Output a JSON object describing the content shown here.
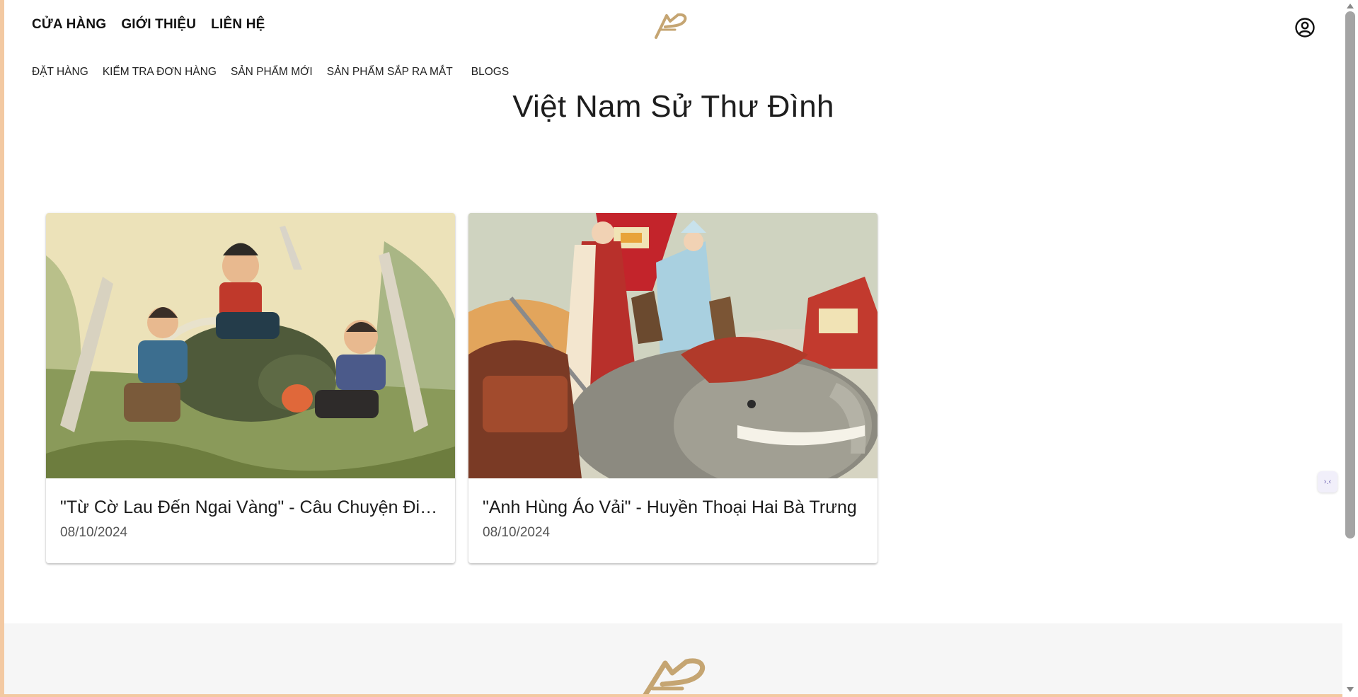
{
  "header": {
    "main_nav": [
      "CỬA HÀNG",
      "GIỚI THIỆU",
      "LIÊN HỆ"
    ],
    "sub_nav": [
      "ĐẶT HÀNG",
      "KIỂM TRA ĐƠN HÀNG",
      "SẢN PHẨM MỚI",
      "SẢN PHẨM SẮP RA MẮT",
      "BLOGS"
    ],
    "logo_icon": "brand-logo-icon",
    "account_icon": "account-circle-icon"
  },
  "page_title": "Việt Nam Sử Thư Đình",
  "posts": [
    {
      "title": "\"Từ Cờ Lau Đến Ngai Vàng\" - Câu Chuyện Đinh Bộ Lĩnh",
      "date": "08/10/2024"
    },
    {
      "title": "\"Anh Hùng Áo Vải\" - Huyền Thoại Hai Bà Trưng",
      "date": "08/10/2024"
    }
  ],
  "widget": {
    "label": "›.‹"
  },
  "colors": {
    "page_border": "#f3c9a2",
    "brand_gold": "#c5a572",
    "footer_bg": "#f6f6f6"
  }
}
